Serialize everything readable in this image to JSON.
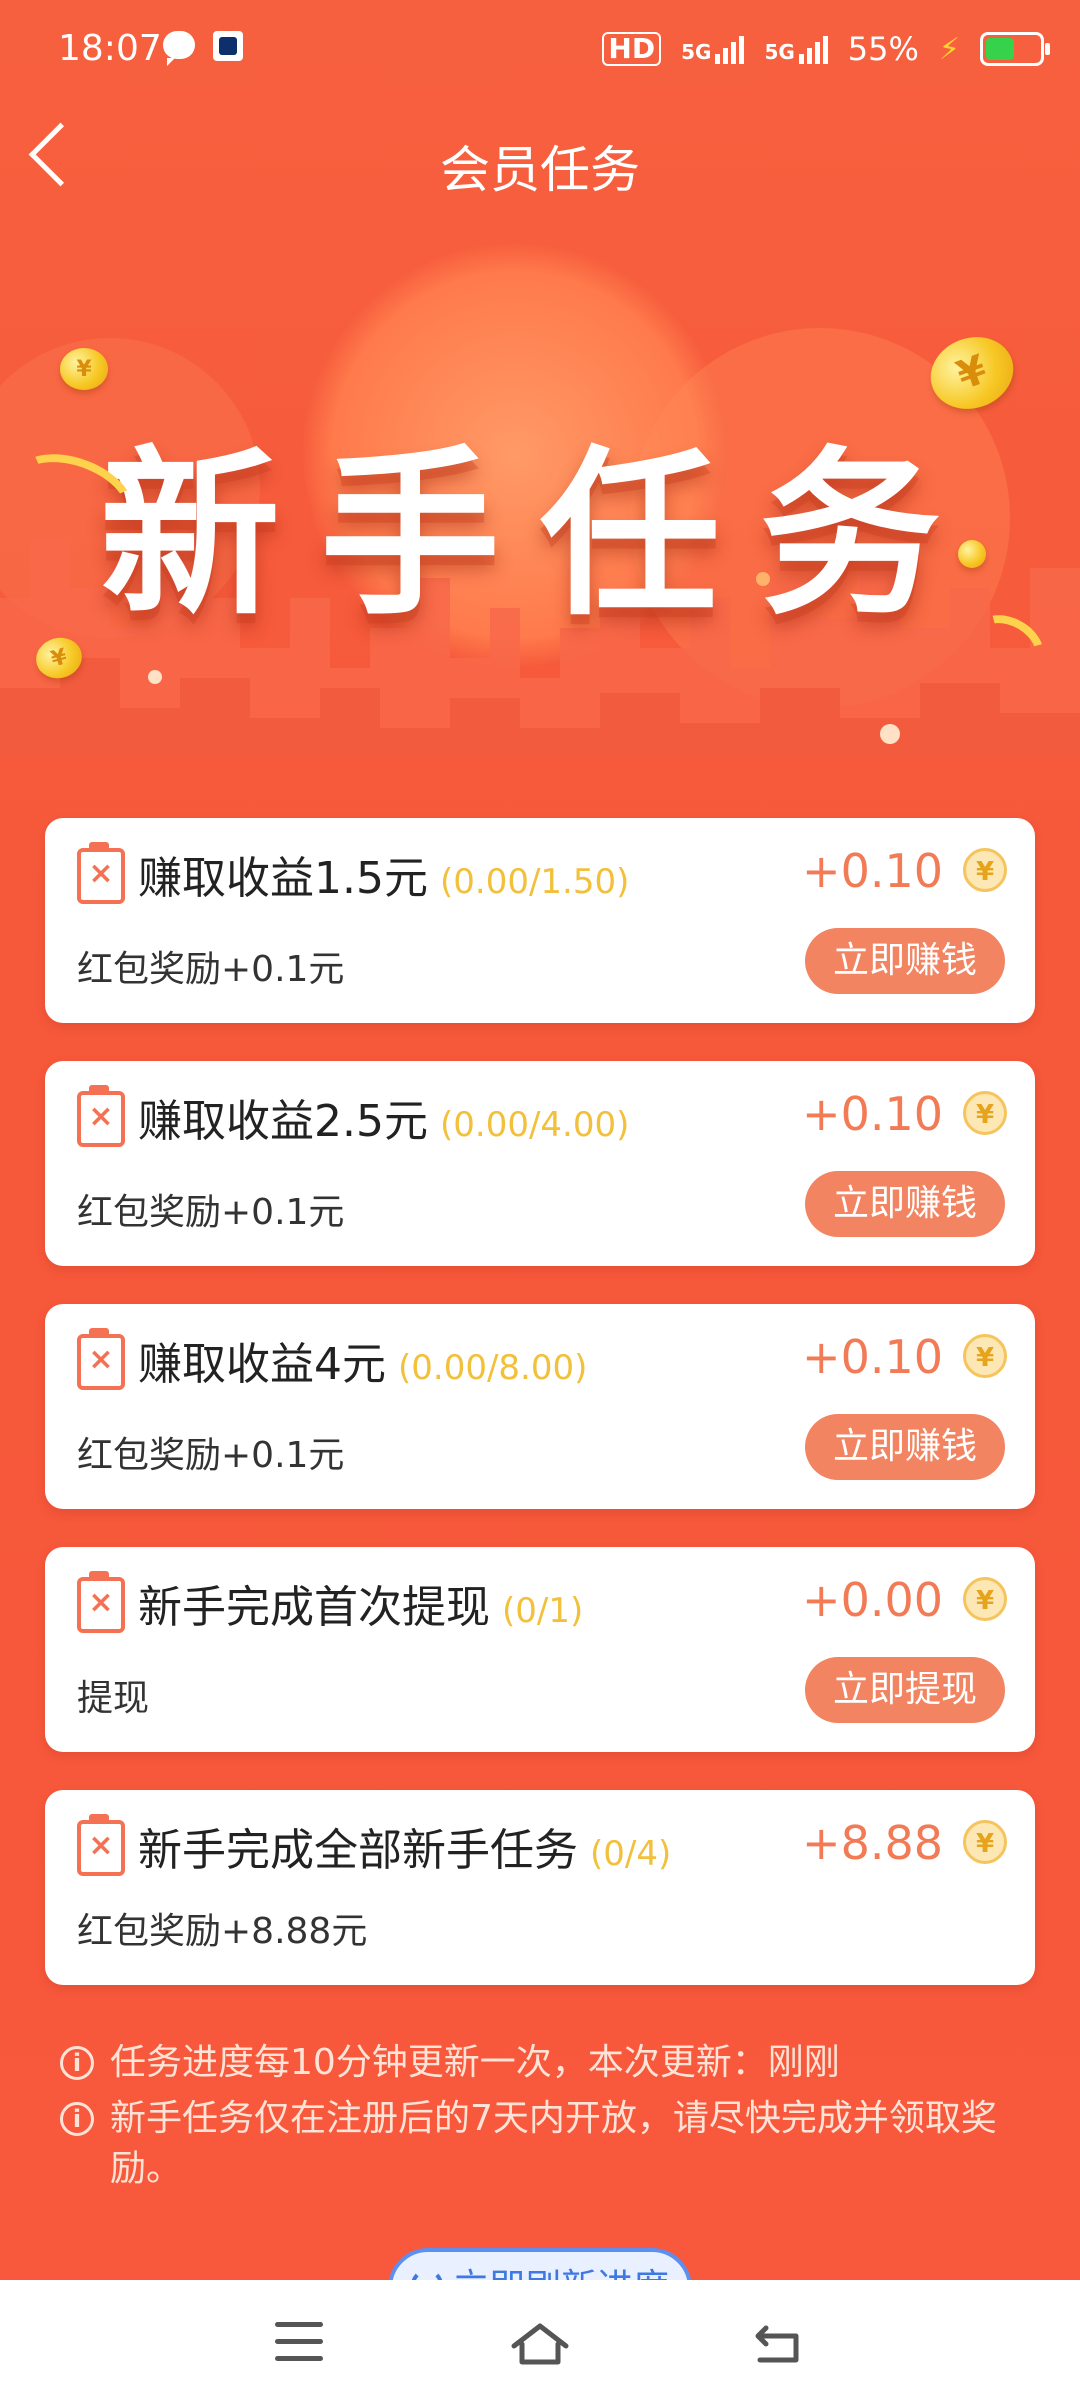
{
  "status_bar": {
    "time": "18:07",
    "hd_label": "HD",
    "network_1": "5G",
    "network_2": "5G",
    "battery_percent": "55%"
  },
  "header": {
    "title": "会员任务"
  },
  "banner": {
    "title": "新手任务"
  },
  "tasks": [
    {
      "title": "赚取收益1.5元",
      "progress": "(0.00/1.50)",
      "reward": "+0.10",
      "reward_icon": "yuan-coin-icon",
      "subtitle": "红包奖励+0.1元",
      "button": "立即赚钱"
    },
    {
      "title": "赚取收益2.5元",
      "progress": "(0.00/4.00)",
      "reward": "+0.10",
      "reward_icon": "yuan-coin-icon",
      "subtitle": "红包奖励+0.1元",
      "button": "立即赚钱"
    },
    {
      "title": "赚取收益4元",
      "progress": "(0.00/8.00)",
      "reward": "+0.10",
      "reward_icon": "yuan-coin-icon",
      "subtitle": "红包奖励+0.1元",
      "button": "立即赚钱"
    },
    {
      "title": "新手完成首次提现",
      "progress": "(0/1)",
      "reward": "+0.00",
      "reward_icon": "yuan-coin-icon",
      "subtitle": "提现",
      "button": "立即提现"
    },
    {
      "title": "新手完成全部新手任务",
      "progress": "(0/4)",
      "reward": "+8.88",
      "reward_icon": "yuan-coin-icon",
      "subtitle": "红包奖励+8.88元"
    }
  ],
  "notes": [
    "任务进度每10分钟更新一次，本次更新：刚刚",
    "新手任务仅在注册后的7天内开放，请尽快完成并领取奖励。"
  ],
  "refresh_button": "立即刷新进度",
  "colors": {
    "background": "#f7593b",
    "reward_text": "#f27a55",
    "progress_text": "#f2c03a",
    "button_bg": "#f28461"
  }
}
